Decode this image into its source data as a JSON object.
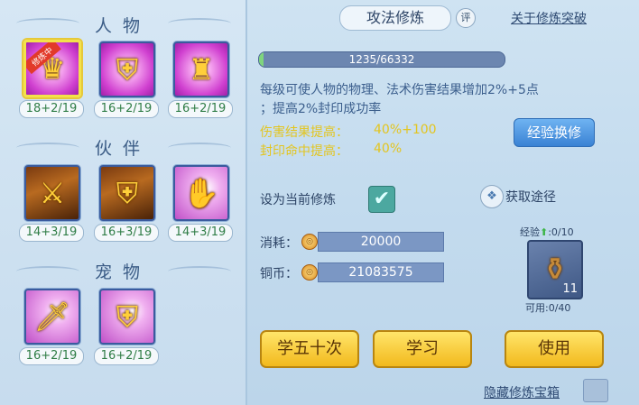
{
  "left": {
    "sections": {
      "character": {
        "title": "人物",
        "items": [
          {
            "icon": "character-skill-1-icon",
            "level": "18+2/19",
            "selected": true,
            "badge": "修炼中"
          },
          {
            "icon": "character-skill-2-icon",
            "level": "16+2/19"
          },
          {
            "icon": "character-skill-3-icon",
            "level": "16+2/19"
          }
        ]
      },
      "partner": {
        "title": "伙伴",
        "items": [
          {
            "icon": "partner-skill-1-icon",
            "level": "14+3/19"
          },
          {
            "icon": "partner-skill-2-icon",
            "level": "16+3/19"
          },
          {
            "icon": "partner-skill-3-icon",
            "level": "14+3/19"
          }
        ]
      },
      "pet": {
        "title": "宠物",
        "items": [
          {
            "icon": "pet-skill-1-icon",
            "level": "16+2/19"
          },
          {
            "icon": "pet-skill-2-icon",
            "level": "16+2/19"
          }
        ]
      }
    }
  },
  "right": {
    "title": "攻法修炼",
    "rate_label": "评",
    "breakthrough_link": "关于修炼突破",
    "progress": {
      "text": "1235/66332",
      "current": 1235,
      "max": 66332
    },
    "description_line1": "每级可使人物的物理、法术伤害结果增加2%+5点",
    "description_line2": "；提高2%封印成功率",
    "stat1_label": "伤害结果提高：",
    "stat1_value": "40%+100",
    "stat2_label": "封印命中提高：",
    "stat2_value": "40%",
    "exchange_button": "经验换修",
    "set_current_label": "设为当前修炼",
    "set_current_checked": true,
    "source_label": "获取途径",
    "cost_label": "消耗：",
    "cost_value": "20000",
    "copper_label": "铜币：",
    "copper_value": "21083575",
    "exp_label": "经验",
    "exp_value": ":0/10",
    "item_count": "11",
    "available": "可用:0/40",
    "learn50_button": "学五十次",
    "learn_button": "学习",
    "use_button": "使用",
    "hide_box_label": "隐藏修炼宝箱",
    "colors": {
      "green_level": "#2f7d46",
      "yellow_stat": "#e3c51f",
      "progress_fill": "#7fd57e"
    }
  }
}
